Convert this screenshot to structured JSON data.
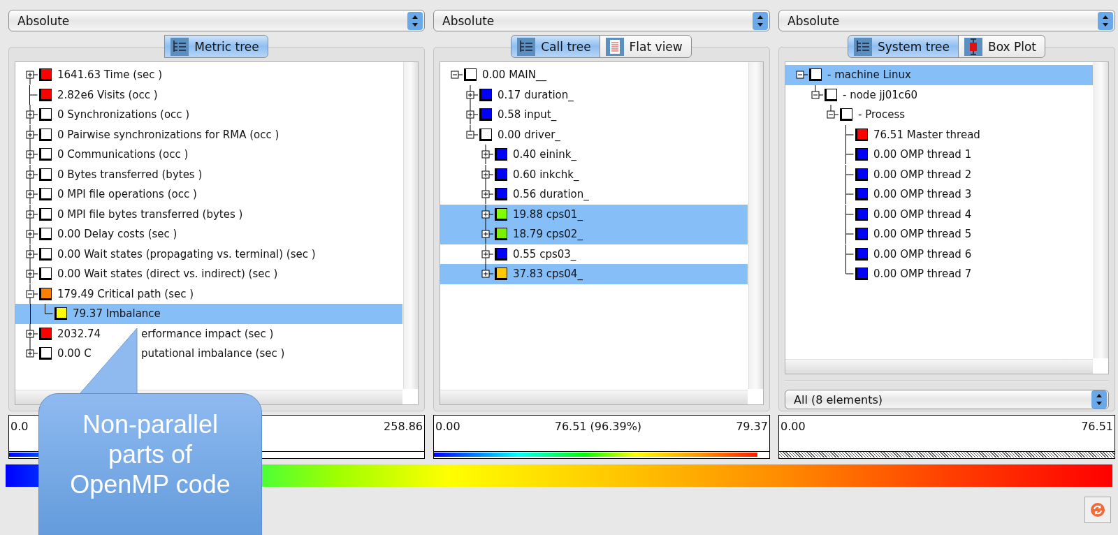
{
  "panels": [
    {
      "mode": "Absolute",
      "tabs": [
        {
          "label": "Metric tree",
          "selected": true
        }
      ],
      "tree": [
        {
          "kind": "branch",
          "expanded": false,
          "selected": false,
          "color": "#ff0000",
          "text": "1641.63 Time (sec )"
        },
        {
          "kind": "leaf",
          "selected": false,
          "color": "#ff0000",
          "text": "2.82e6 Visits (occ )"
        },
        {
          "kind": "branch",
          "expanded": false,
          "selected": false,
          "color": "#ffffff",
          "text": "0 Synchronizations (occ )"
        },
        {
          "kind": "branch",
          "expanded": false,
          "selected": false,
          "color": "#ffffff",
          "text": "0 Pairwise synchronizations for RMA (occ )"
        },
        {
          "kind": "branch",
          "expanded": false,
          "selected": false,
          "color": "#ffffff",
          "text": "0 Communications (occ )"
        },
        {
          "kind": "branch",
          "expanded": false,
          "selected": false,
          "color": "#ffffff",
          "text": "0 Bytes transferred (bytes )"
        },
        {
          "kind": "branch",
          "expanded": false,
          "selected": false,
          "color": "#ffffff",
          "text": "0 MPI file operations (occ )"
        },
        {
          "kind": "branch",
          "expanded": false,
          "selected": false,
          "color": "#ffffff",
          "text": "0 MPI file bytes transferred (bytes )"
        },
        {
          "kind": "branch",
          "expanded": false,
          "selected": false,
          "color": "#ffffff",
          "text": "0.00 Delay costs (sec )"
        },
        {
          "kind": "branch",
          "expanded": false,
          "selected": false,
          "color": "#ffffff",
          "text": "0.00 Wait states (propagating vs. terminal) (sec )"
        },
        {
          "kind": "branch",
          "expanded": false,
          "selected": false,
          "color": "#ffffff",
          "text": "0.00 Wait states (direct vs. indirect) (sec )"
        },
        {
          "kind": "branch",
          "expanded": true,
          "selected": false,
          "color": "#ff8000",
          "text": "179.49 Critical path (sec )",
          "children": [
            {
              "kind": "leaf",
              "selected": true,
              "color": "#ffff00",
              "text": "79.37 Imbalance"
            }
          ]
        },
        {
          "kind": "branch",
          "expanded": false,
          "selected": false,
          "color": "#ff0000",
          "text": "2032.74",
          "text_after_gap": "erformance impact (sec )"
        },
        {
          "kind": "branch",
          "expanded": false,
          "selected": false,
          "color": "#ffffff",
          "text": "0.00 C",
          "text_after_gap": "putational imbalance (sec )"
        }
      ],
      "legend": {
        "kind": "gradient",
        "min": "0.0",
        "max": "258.86",
        "level": 0.3
      }
    },
    {
      "mode": "Absolute",
      "tabs": [
        {
          "label": "Call tree",
          "selected": true
        },
        {
          "label": "Flat view",
          "selected": false
        }
      ],
      "tree": [
        {
          "kind": "branch",
          "expanded": true,
          "selected": false,
          "color": "#ffffff",
          "text": "0.00 MAIN__",
          "children": [
            {
              "kind": "branch",
              "expanded": false,
              "selected": false,
              "color": "#0000ff",
              "text": "0.17 duration_"
            },
            {
              "kind": "branch",
              "expanded": false,
              "selected": false,
              "color": "#0000ff",
              "text": "0.58 input_"
            },
            {
              "kind": "branch",
              "expanded": true,
              "selected": false,
              "color": "#ffffff",
              "text": "0.00 driver_",
              "children": [
                {
                  "kind": "branch",
                  "expanded": false,
                  "selected": false,
                  "color": "#0000ff",
                  "text": "0.40 einink_"
                },
                {
                  "kind": "branch",
                  "expanded": false,
                  "selected": false,
                  "color": "#0000ff",
                  "text": "0.60 inkchk_"
                },
                {
                  "kind": "branch",
                  "expanded": false,
                  "selected": false,
                  "color": "#0000ff",
                  "text": "0.56 duration_"
                },
                {
                  "kind": "branch",
                  "expanded": false,
                  "selected": true,
                  "color": "#80ff00",
                  "text": "19.88 cps01_"
                },
                {
                  "kind": "branch",
                  "expanded": false,
                  "selected": true,
                  "color": "#78f000",
                  "text": "18.79 cps02_"
                },
                {
                  "kind": "branch",
                  "expanded": false,
                  "selected": false,
                  "color": "#0000ff",
                  "text": "0.55 cps03_"
                },
                {
                  "kind": "branch",
                  "expanded": false,
                  "selected": true,
                  "color": "#ffc800",
                  "text": "37.83 cps04_"
                }
              ]
            }
          ]
        }
      ],
      "legend": {
        "kind": "gradient",
        "min": "0.00",
        "mid": "76.51 (96.39%)",
        "max": "79.37",
        "level": 0.964
      }
    },
    {
      "mode": "Absolute",
      "tabs": [
        {
          "label": "System tree",
          "selected": true
        },
        {
          "label": "Box Plot",
          "selected": false
        }
      ],
      "tree": [
        {
          "kind": "branch",
          "expanded": true,
          "selected": true,
          "color": "#ffffff",
          "text": "- machine Linux",
          "children": [
            {
              "kind": "branch",
              "expanded": true,
              "selected": false,
              "color": "#ffffff",
              "text": "- node jj01c60",
              "children": [
                {
                  "kind": "branch",
                  "expanded": true,
                  "selected": false,
                  "color": "#ffffff",
                  "text": "- Process",
                  "children": [
                    {
                      "kind": "leaf",
                      "selected": false,
                      "color": "#ff0000",
                      "text": "76.51 Master thread"
                    },
                    {
                      "kind": "leaf",
                      "selected": false,
                      "color": "#0000ff",
                      "text": "0.00 OMP thread 1"
                    },
                    {
                      "kind": "leaf",
                      "selected": false,
                      "color": "#0000ff",
                      "text": "0.00 OMP thread 2"
                    },
                    {
                      "kind": "leaf",
                      "selected": false,
                      "color": "#0000ff",
                      "text": "0.00 OMP thread 3"
                    },
                    {
                      "kind": "leaf",
                      "selected": false,
                      "color": "#0000ff",
                      "text": "0.00 OMP thread 4"
                    },
                    {
                      "kind": "leaf",
                      "selected": false,
                      "color": "#0000ff",
                      "text": "0.00 OMP thread 5"
                    },
                    {
                      "kind": "leaf",
                      "selected": false,
                      "color": "#0000ff",
                      "text": "0.00 OMP thread 6"
                    },
                    {
                      "kind": "leaf",
                      "selected": false,
                      "color": "#0000ff",
                      "text": "0.00 OMP thread 7"
                    }
                  ]
                }
              ]
            }
          ]
        }
      ],
      "filter": "All (8 elements)",
      "legend": {
        "kind": "hatched",
        "min": "0.00",
        "max": "76.51"
      }
    }
  ],
  "callout": {
    "text": "Non-parallel parts of OpenMP code"
  }
}
